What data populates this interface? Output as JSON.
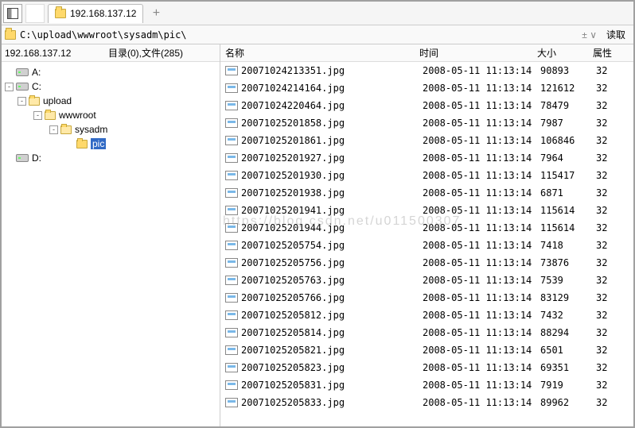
{
  "tab": {
    "title": "192.168.137.12"
  },
  "pathbar": {
    "path": "C:\\upload\\wwwroot\\sysadm\\pic\\",
    "ctrl": "± ∨",
    "read": "读取"
  },
  "sidebar": {
    "ip": "192.168.137.12",
    "summary": "目录(0),文件(285)",
    "tree": [
      {
        "indent": 0,
        "type": "drive",
        "expander": "",
        "label": "A:"
      },
      {
        "indent": 0,
        "type": "drive",
        "expander": "-",
        "label": "C:"
      },
      {
        "indent": 1,
        "type": "folder",
        "expander": "-",
        "label": "upload"
      },
      {
        "indent": 2,
        "type": "folder",
        "expander": "-",
        "label": "wwwroot"
      },
      {
        "indent": 3,
        "type": "folder",
        "expander": "-",
        "label": "sysadm"
      },
      {
        "indent": 4,
        "type": "folder-sel",
        "expander": "",
        "label": "pic"
      },
      {
        "indent": 0,
        "type": "drive",
        "expander": "",
        "label": "D:"
      }
    ]
  },
  "list": {
    "headers": {
      "name": "名称",
      "time": "时间",
      "size": "大小",
      "attr": "属性"
    },
    "files": [
      {
        "name": "20071024213351.jpg",
        "time": "2008-05-11 11:13:14",
        "size": "90893",
        "attr": "32"
      },
      {
        "name": "20071024214164.jpg",
        "time": "2008-05-11 11:13:14",
        "size": "121612",
        "attr": "32"
      },
      {
        "name": "20071024220464.jpg",
        "time": "2008-05-11 11:13:14",
        "size": "78479",
        "attr": "32"
      },
      {
        "name": "20071025201858.jpg",
        "time": "2008-05-11 11:13:14",
        "size": "7987",
        "attr": "32"
      },
      {
        "name": "20071025201861.jpg",
        "time": "2008-05-11 11:13:14",
        "size": "106846",
        "attr": "32"
      },
      {
        "name": "20071025201927.jpg",
        "time": "2008-05-11 11:13:14",
        "size": "7964",
        "attr": "32"
      },
      {
        "name": "20071025201930.jpg",
        "time": "2008-05-11 11:13:14",
        "size": "115417",
        "attr": "32"
      },
      {
        "name": "20071025201938.jpg",
        "time": "2008-05-11 11:13:14",
        "size": "6871",
        "attr": "32"
      },
      {
        "name": "20071025201941.jpg",
        "time": "2008-05-11 11:13:14",
        "size": "115614",
        "attr": "32"
      },
      {
        "name": "20071025201944.jpg",
        "time": "2008-05-11 11:13:14",
        "size": "115614",
        "attr": "32"
      },
      {
        "name": "20071025205754.jpg",
        "time": "2008-05-11 11:13:14",
        "size": "7418",
        "attr": "32"
      },
      {
        "name": "20071025205756.jpg",
        "time": "2008-05-11 11:13:14",
        "size": "73876",
        "attr": "32"
      },
      {
        "name": "20071025205763.jpg",
        "time": "2008-05-11 11:13:14",
        "size": "7539",
        "attr": "32"
      },
      {
        "name": "20071025205766.jpg",
        "time": "2008-05-11 11:13:14",
        "size": "83129",
        "attr": "32"
      },
      {
        "name": "20071025205812.jpg",
        "time": "2008-05-11 11:13:14",
        "size": "7432",
        "attr": "32"
      },
      {
        "name": "20071025205814.jpg",
        "time": "2008-05-11 11:13:14",
        "size": "88294",
        "attr": "32"
      },
      {
        "name": "20071025205821.jpg",
        "time": "2008-05-11 11:13:14",
        "size": "6501",
        "attr": "32"
      },
      {
        "name": "20071025205823.jpg",
        "time": "2008-05-11 11:13:14",
        "size": "69351",
        "attr": "32"
      },
      {
        "name": "20071025205831.jpg",
        "time": "2008-05-11 11:13:14",
        "size": "7919",
        "attr": "32"
      },
      {
        "name": "20071025205833.jpg",
        "time": "2008-05-11 11:13:14",
        "size": "89962",
        "attr": "32"
      }
    ]
  },
  "watermark": "https://blog.csdn.net/u011500307"
}
